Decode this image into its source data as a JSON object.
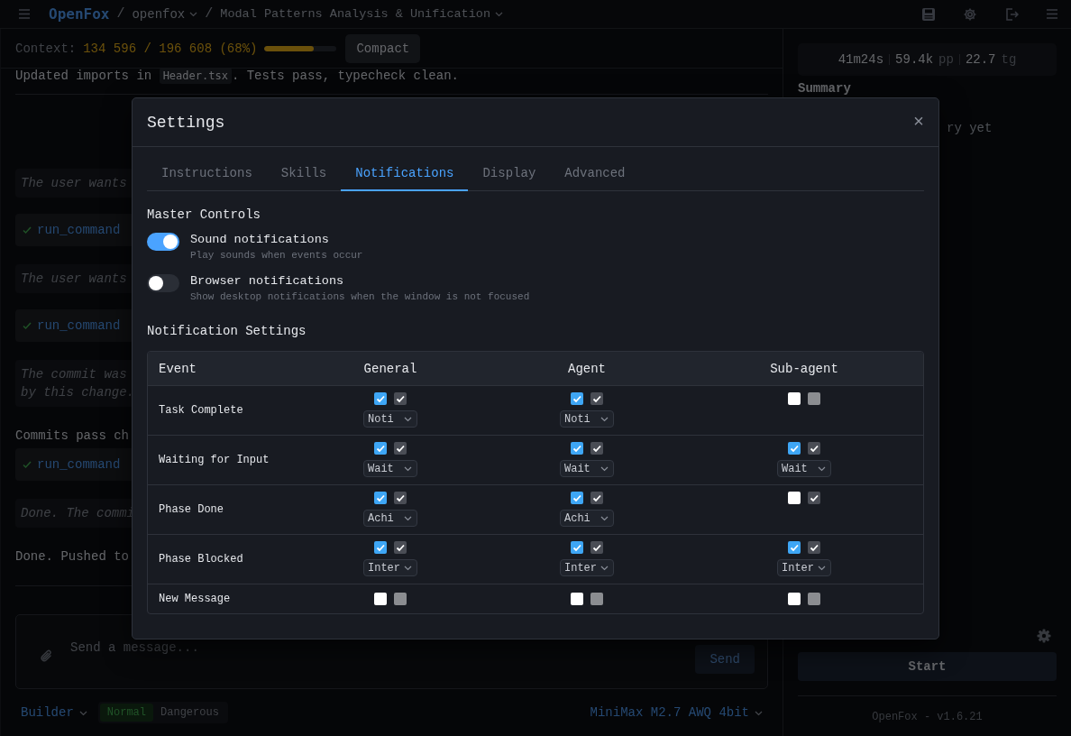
{
  "header": {
    "brand": "OpenFox",
    "separator": "/",
    "project": "openfox",
    "session": "Modal Patterns Analysis & Unification"
  },
  "context": {
    "label": "Context:",
    "reading": "134 596 / 196 608 (68%)",
    "level": 0.68,
    "button": "Compact"
  },
  "chat": [
    {
      "kind": "text",
      "before": "Updated imports in ",
      "code": "Header.tsx",
      "after": ". Tests pass, typecheck clean."
    },
    {
      "kind": "thought",
      "lines": [
        "The user wants"
      ]
    },
    {
      "kind": "tool",
      "name": "run_command"
    },
    {
      "kind": "thought",
      "lines": [
        "The user wants"
      ]
    },
    {
      "kind": "tool",
      "name": "run_command"
    },
    {
      "kind": "thought",
      "lines": [
        "The commit was",
        "by this change."
      ]
    },
    {
      "kind": "plain",
      "text": "Commits pass ch"
    },
    {
      "kind": "tool",
      "name": "run_command"
    },
    {
      "kind": "thought",
      "lines": [
        "Done. The commi"
      ]
    },
    {
      "kind": "plain",
      "text": "Done. Pushed to"
    }
  ],
  "composer": {
    "placeholder": "Send a message...",
    "send": "Send"
  },
  "footer": {
    "mode": "Builder",
    "safety": [
      {
        "label": "Normal",
        "selected": true
      },
      {
        "label": "Dangerous",
        "selected": false
      }
    ],
    "model": "MiniMax M2.7 AWQ 4bit"
  },
  "side": {
    "stats": [
      {
        "value": "41m24s"
      },
      {
        "value": "59.4k",
        "unit": "pp"
      },
      {
        "value": "22.7",
        "unit": "tg"
      }
    ],
    "summary_title": "Summary",
    "summary_text": "ry yet",
    "start": "Start",
    "version": "OpenFox - v1.6.21"
  },
  "modal": {
    "title": "Settings",
    "close": "×",
    "tabs": [
      {
        "label": "Instructions",
        "selected": false
      },
      {
        "label": "Skills",
        "selected": false
      },
      {
        "label": "Notifications",
        "selected": true
      },
      {
        "label": "Display",
        "selected": false
      },
      {
        "label": "Advanced",
        "selected": false
      }
    ],
    "master_title": "Master Controls",
    "toggles": [
      {
        "label": "Sound notifications",
        "description": "Play sounds when events occur",
        "on": true
      },
      {
        "label": "Browser notifications",
        "description": "Show desktop notifications when the window is not focused",
        "on": false
      }
    ],
    "table_title": "Notification Settings",
    "columns": [
      "Event",
      "General",
      "Agent",
      "Sub-agent"
    ],
    "rows": [
      {
        "cells": [
          {
            "kind": "event",
            "text": "Task Complete"
          },
          {
            "sound": true,
            "browser": true,
            "choice": "Noti"
          },
          {
            "sound": true,
            "browser": true,
            "choice": "Noti"
          },
          {
            "sound": false,
            "browser": false
          }
        ]
      },
      {
        "cells": [
          {
            "kind": "event",
            "text": "Waiting for Input"
          },
          {
            "sound": true,
            "browser": true,
            "choice": "Wait"
          },
          {
            "sound": true,
            "browser": true,
            "choice": "Wait"
          },
          {
            "sound": true,
            "browser": true,
            "choice": "Wait"
          }
        ]
      },
      {
        "cells": [
          {
            "kind": "event",
            "text": "Phase Done"
          },
          {
            "sound": true,
            "browser": true,
            "choice": "Achi"
          },
          {
            "sound": true,
            "browser": true,
            "choice": "Achi"
          },
          {
            "sound": false,
            "browser": true
          }
        ]
      },
      {
        "cells": [
          {
            "kind": "event",
            "text": "Phase Blocked"
          },
          {
            "sound": true,
            "browser": true,
            "choice": "Inter"
          },
          {
            "sound": true,
            "browser": true,
            "choice": "Inter"
          },
          {
            "sound": true,
            "browser": true,
            "choice": "Inter"
          }
        ]
      },
      {
        "cells": [
          {
            "kind": "event",
            "text": "New Message"
          },
          {
            "sound": false,
            "browser": false
          },
          {
            "sound": false,
            "browser": false
          },
          {
            "sound": false,
            "browser": false
          }
        ]
      }
    ]
  }
}
